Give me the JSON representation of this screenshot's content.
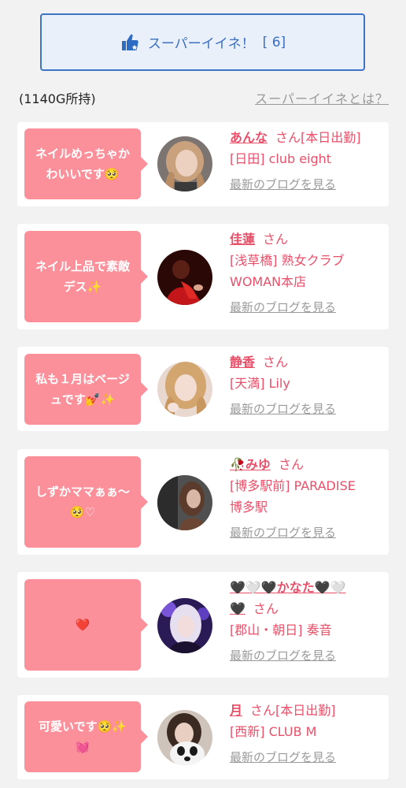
{
  "super_like": {
    "label": "スーパーイイネ！",
    "count": "[ 6]"
  },
  "points": "(1140G所持)",
  "help_link": "スーパーイイネとは？",
  "cards": [
    {
      "comment_lines": [
        "ネイルめっちゃか",
        "わいいです🥺"
      ],
      "name": "あんな",
      "suffix": "さん[本日出勤]",
      "store_lines": [
        "[日田] club eight"
      ],
      "blog": "最新のブログを見る"
    },
    {
      "comment_lines": [
        "ネイル上品で素敵",
        "デス✨"
      ],
      "name": "佳蓮",
      "suffix": "さん",
      "store_lines": [
        "[浅草橋] 熟女クラブ",
        "WOMAN本店"
      ],
      "blog": "最新のブログを見る"
    },
    {
      "comment_lines": [
        "私も１月はベージ",
        "ュです💅✨"
      ],
      "name": "静香",
      "suffix": "さん",
      "store_lines": [
        "[天満] Lily"
      ],
      "blog": "最新のブログを見る"
    },
    {
      "comment_lines": [
        "しずかママぁぁ〜",
        "🥺♡"
      ],
      "name": "🥀みゆ",
      "suffix": "さん",
      "store_lines": [
        "[博多駅前] PARADISE",
        "博多駅"
      ],
      "blog": "最新のブログを見る"
    },
    {
      "comment_lines": [
        "❤️"
      ],
      "name": "🖤🤍🖤かなた🖤🤍",
      "name_line2": "🖤",
      "suffix": "さん",
      "store_lines": [
        "[郡山・朝日] 奏音"
      ],
      "blog": "最新のブログを見る"
    },
    {
      "comment_lines": [
        "可愛いです🥺✨",
        "💓"
      ],
      "name": "月",
      "suffix": "さん[本日出勤]",
      "store_lines": [
        "[西新] CLUB M"
      ],
      "blog": "最新のブログを見る"
    }
  ]
}
